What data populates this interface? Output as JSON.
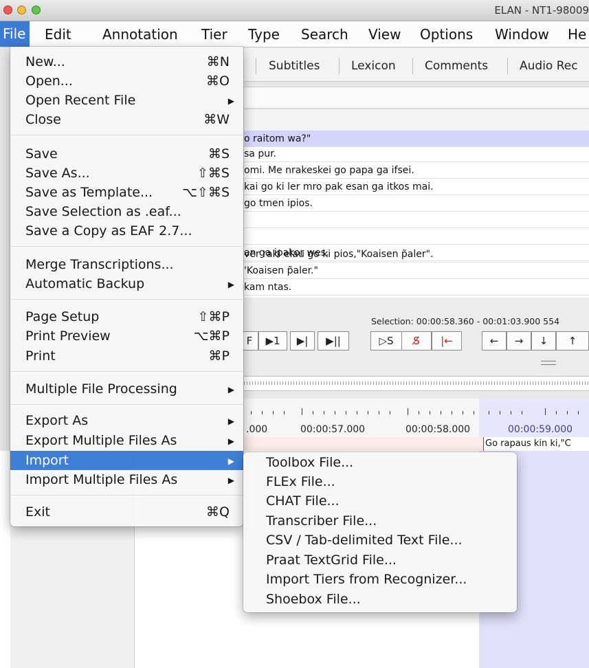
{
  "window": {
    "title": "ELAN - NT1-98009",
    "traffic_lights": [
      "close",
      "minimize",
      "zoom"
    ]
  },
  "menubar": {
    "items": [
      "File",
      "Edit",
      "Annotation",
      "Tier",
      "Type",
      "Search",
      "View",
      "Options",
      "Window",
      "He"
    ],
    "active": "File"
  },
  "background": {
    "tabs": [
      "Subtitles",
      "Lexicon",
      "Comments",
      "Audio Rec"
    ],
    "subtitle_lines": [
      "o raitom wa?\"",
      "sa pur.",
      "omi. Me nrakeskei go papa ga ifsei.",
      "kai go ki ler mro pak esan ga itkos mai.",
      "go tmen ipios.",
      "",
      "",
      "an ga ipakor wes.",
      "ver raki elau go ki pios,\"Koaisen p̃aler\".",
      "'Koaisen p̃aler.\"",
      " kam ntas."
    ],
    "selection_text": "Selection: 00:00:58.360 - 00:01:03.900  554",
    "controls": [
      "F",
      "▶1",
      "▶|",
      "▶||",
      "▷S",
      "S̸",
      "|←",
      "←",
      "→",
      "↓",
      "↑"
    ],
    "ruler_times": [
      ".000",
      "00:00:57.000",
      "00:00:58.000",
      "00:00:59.000"
    ],
    "annotation_cell": "Go rapaus kin ki,\"C"
  },
  "file_menu": {
    "items": [
      {
        "label": "New...",
        "shortcut": "⌘N"
      },
      {
        "label": "Open...",
        "shortcut": "⌘O"
      },
      {
        "label": "Open Recent File",
        "submenu": true
      },
      {
        "label": "Close",
        "shortcut": "⌘W"
      },
      {
        "label": "Save",
        "shortcut": "⌘S"
      },
      {
        "label": "Save As...",
        "shortcut": "⇧⌘S"
      },
      {
        "label": "Save as Template...",
        "shortcut": "⌥⇧⌘S"
      },
      {
        "label": "Save Selection as .eaf..."
      },
      {
        "label": "Save a Copy as EAF 2.7..."
      },
      {
        "label": "Merge Transcriptions..."
      },
      {
        "label": "Automatic Backup",
        "submenu": true
      },
      {
        "label": "Page Setup",
        "shortcut": "⇧⌘P"
      },
      {
        "label": "Print Preview",
        "shortcut": "⌥⌘P"
      },
      {
        "label": "Print",
        "shortcut": "⌘P"
      },
      {
        "label": "Multiple File Processing",
        "submenu": true
      },
      {
        "label": "Export As",
        "submenu": true
      },
      {
        "label": "Export Multiple Files As",
        "submenu": true
      },
      {
        "label": "Import",
        "submenu": true,
        "selected": true
      },
      {
        "label": "Import Multiple Files As",
        "submenu": true
      },
      {
        "label": "Exit",
        "shortcut": "⌘Q"
      }
    ],
    "submenu_arrow": "▶"
  },
  "import_submenu": {
    "items": [
      "Toolbox File...",
      "FLEx File...",
      "CHAT File...",
      "Transcriber File...",
      "CSV / Tab-delimited Text File...",
      "Praat TextGrid File...",
      "Import Tiers from Recognizer...",
      "Shoebox File..."
    ]
  },
  "colors": {
    "selection_blue": "#3a7bd5",
    "subtitle_highlight": "#d5d5fb",
    "annotation_tier": "#fbeaea"
  }
}
